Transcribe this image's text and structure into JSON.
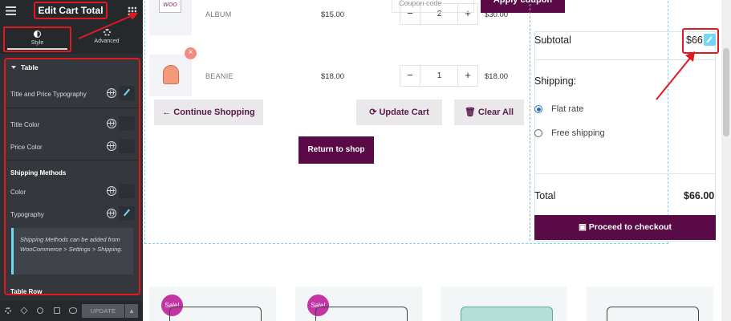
{
  "panel": {
    "title": "Edit Cart Total",
    "tabs": {
      "style": "Style",
      "advanced": "Advanced"
    },
    "section_table": "Table",
    "controls": {
      "title_price_typography": "Title and Price Typography",
      "title_color": "Title Color",
      "price_color": "Price Color",
      "shipping_methods": "Shipping Methods",
      "color": "Color",
      "typography": "Typography",
      "note": "Shipping Methods can be added from WooCommerce > Settings > Shipping.",
      "table_row": "Table Row"
    },
    "footer": {
      "update": "UPDATE",
      "caret": "▴"
    }
  },
  "cart": {
    "items": [
      {
        "thumb_text": "WOO",
        "name": "ALBUM",
        "price": "$15.00",
        "qty": "2",
        "subtotal": "$30.00"
      },
      {
        "thumb_text": "",
        "name": "BEANIE",
        "price": "$18.00",
        "qty": "1",
        "subtotal": "$18.00"
      }
    ],
    "minus": "−",
    "plus": "+",
    "remove": "×",
    "continue_shopping": "← Continue Shopping",
    "update_cart": "⟳ Update Cart",
    "clear_all": "🗑 Clear All",
    "return_to_shop": "Return to shop"
  },
  "totals": {
    "coupon_placeholder": "Coupon code",
    "apply_coupon": "Apply coupon",
    "subtotal_label": "Subtotal",
    "subtotal_value": "$66",
    "shipping_label": "Shipping:",
    "shipping_options": [
      "Flat rate",
      "Free shipping"
    ],
    "total_label": "Total",
    "total_value": "$66.00",
    "checkout": "Proceed to checkout",
    "checkout_icon": "▣"
  },
  "products": {
    "sale": "Sale!"
  },
  "colors": {
    "accent": "#5a0a46",
    "highlight": "#e0191f",
    "elementor_blue": "#71d7f7"
  }
}
